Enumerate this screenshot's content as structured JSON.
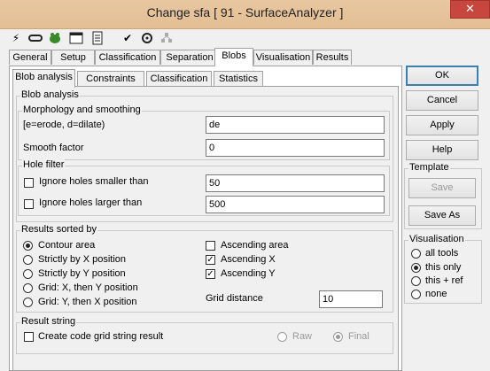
{
  "window": {
    "title": "Change sfa [ 91 - SurfaceAnalyzer ]",
    "close_glyph": "✕"
  },
  "toolbar_icons": [
    "lightning-icon",
    "link-icon",
    "frog-icon",
    "console-icon",
    "list-icon",
    "check-icon",
    "tools-icon",
    "network-icon"
  ],
  "main_tabs": [
    "General",
    "Setup",
    "Classification",
    "Separation",
    "Blobs",
    "Visualisation",
    "Results"
  ],
  "main_tab_active": "Blobs",
  "sub_tabs": [
    "Blob analysis",
    "Constraints",
    "Classification",
    "Statistics"
  ],
  "sub_tab_active": "Blob analysis",
  "blob": {
    "group_title": "Blob analysis",
    "morph": {
      "title": "Morphology and smoothing",
      "ops_label": "[e=erode, d=dilate)",
      "ops_value": "de",
      "smooth_label": "Smooth factor",
      "smooth_value": "0"
    },
    "hole": {
      "title": "Hole filter",
      "smaller_label": "Ignore holes smaller than",
      "smaller_value": "50",
      "smaller_checked": false,
      "larger_label": "Ignore holes larger than",
      "larger_value": "500",
      "larger_checked": false
    },
    "sorted": {
      "title": "Results sorted by",
      "options": [
        "Contour area",
        "Strictly by X position",
        "Strictly by Y position",
        "Grid: X, then Y position",
        "Grid: Y, then X position"
      ],
      "selected": "Contour area",
      "asc_area": "Ascending area",
      "asc_x": "Ascending X",
      "asc_y": "Ascending Y",
      "grid_label": "Grid distance",
      "grid_value": "10"
    },
    "result_string": {
      "title": "Result string",
      "create_label": "Create code grid string result",
      "raw": "Raw",
      "final": "Final"
    }
  },
  "buttons": {
    "ok": "OK",
    "cancel": "Cancel",
    "apply": "Apply",
    "help": "Help"
  },
  "template": {
    "title": "Template",
    "save": "Save",
    "save_as": "Save As"
  },
  "visualisation": {
    "title": "Visualisation",
    "options": [
      "all tools",
      "this only",
      "this + ref",
      "none"
    ],
    "selected": "this only"
  }
}
